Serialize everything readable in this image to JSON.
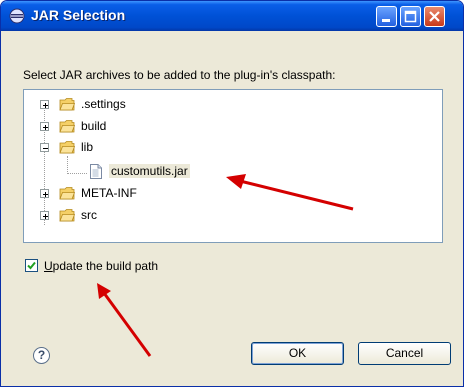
{
  "window": {
    "title": "JAR Selection"
  },
  "dialog": {
    "prompt": "Select JAR archives to be added to the plug-in's classpath:"
  },
  "tree": {
    "items": [
      {
        "label": ".settings",
        "expanded": false
      },
      {
        "label": "build",
        "expanded": false
      },
      {
        "label": "lib",
        "expanded": true
      },
      {
        "label": "customutils.jar",
        "selected": true
      },
      {
        "label": "META-INF",
        "expanded": false
      },
      {
        "label": "src",
        "expanded": false
      }
    ]
  },
  "options": {
    "update_build_path": {
      "label": "Update the build path",
      "checked": true
    }
  },
  "buttons": {
    "ok": "OK",
    "cancel": "Cancel",
    "help": "?"
  },
  "colors": {
    "titlebar": "#0054e3",
    "annotation_arrow": "#d40000",
    "dialog_bg": "#ece9d8"
  },
  "icons": [
    "eclipse-icon",
    "minimize-icon",
    "maximize-icon",
    "close-icon",
    "folder-icon",
    "jar-file-icon",
    "help-icon",
    "checkmark-icon"
  ]
}
